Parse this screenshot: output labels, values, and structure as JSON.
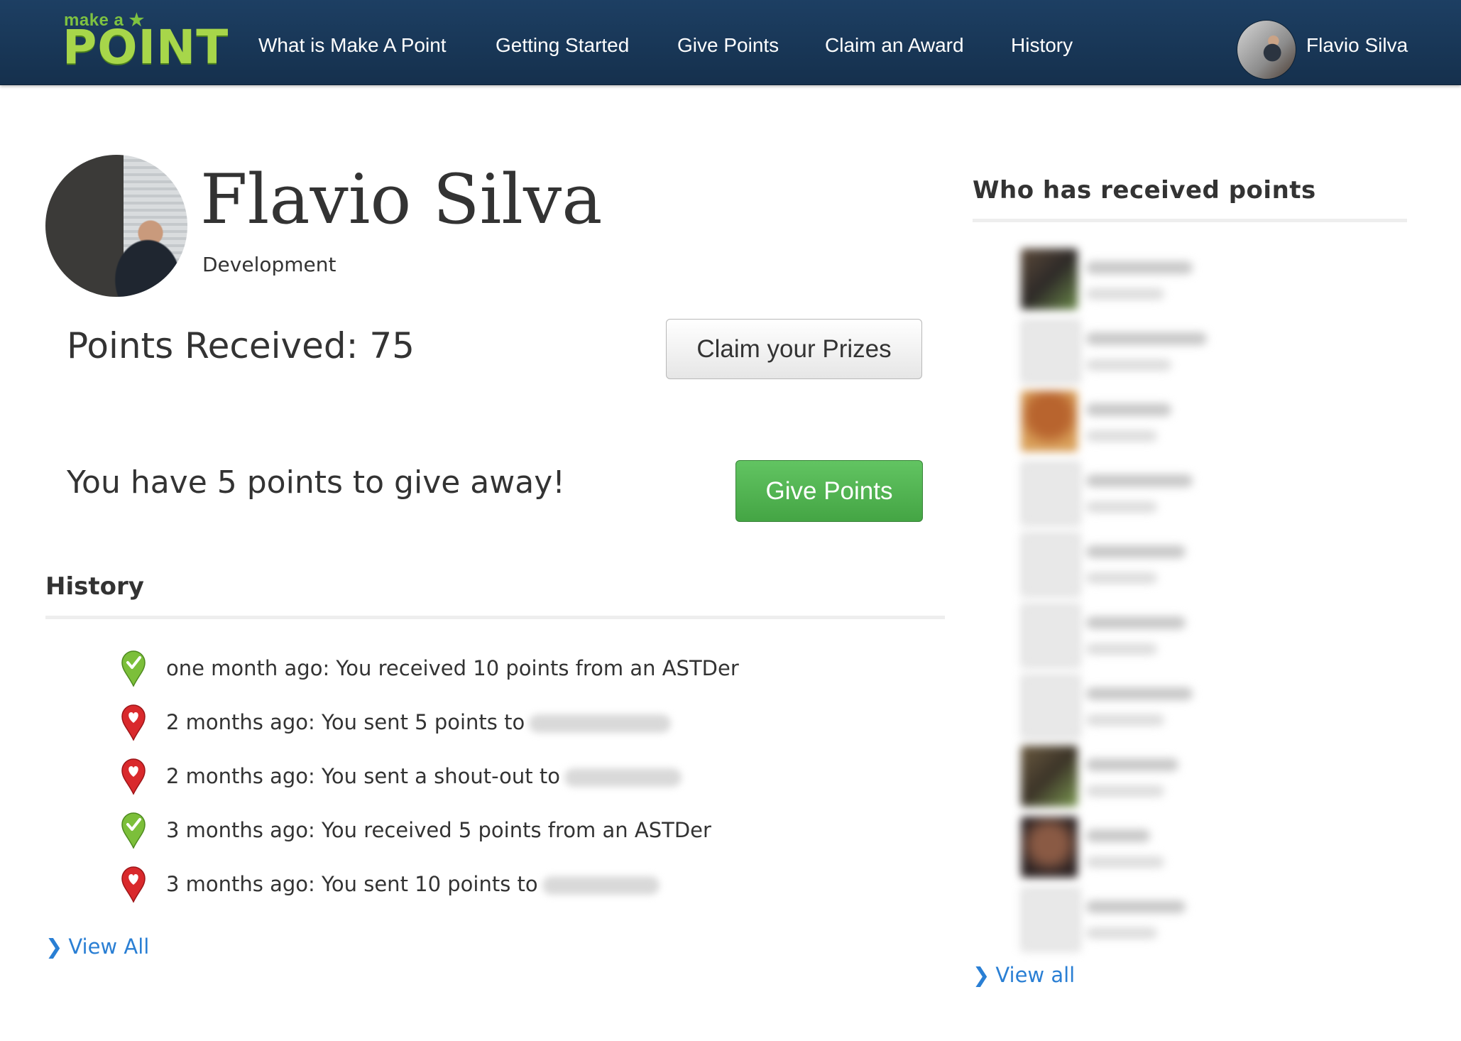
{
  "header": {
    "logo_small": "make a ★",
    "logo_big": "POINT",
    "nav": [
      {
        "label": "What is Make A Point"
      },
      {
        "label": "Getting Started"
      },
      {
        "label": "Give Points"
      },
      {
        "label": "Claim an Award"
      },
      {
        "label": "History"
      }
    ],
    "user_name": "Flavio Silva"
  },
  "profile": {
    "name": "Flavio Silva",
    "department": "Development",
    "points_received": "Points Received: 75",
    "claim_button": "Claim your Prizes",
    "give_away_text": "You have 5 points to give away!",
    "give_button": "Give Points"
  },
  "history": {
    "title": "History",
    "items": [
      {
        "icon": "green-check-pin-icon",
        "text": "one month ago: You received 10 points from an ASTDer",
        "redacted": false
      },
      {
        "icon": "red-heart-pin-icon",
        "text": "2 months ago: You sent 5 points to",
        "redacted": true
      },
      {
        "icon": "red-heart-pin-icon",
        "text": "2 months ago: You sent a shout-out to",
        "redacted": true
      },
      {
        "icon": "green-check-pin-icon",
        "text": "3 months ago: You received 5 points from an ASTDer",
        "redacted": false
      },
      {
        "icon": "red-heart-pin-icon",
        "text": "3 months ago: You sent 10 points to",
        "redacted": true
      }
    ],
    "view_all": "View All"
  },
  "sidebar": {
    "title": "Who has received points",
    "view_all": "View all"
  },
  "colors": {
    "header_bg": "#1a3a5c",
    "logo_green": "#a7d64a",
    "give_button": "#4cae4c",
    "link": "#2a7fd4",
    "pin_green": "#7cbf3a",
    "pin_red": "#d9292c"
  }
}
